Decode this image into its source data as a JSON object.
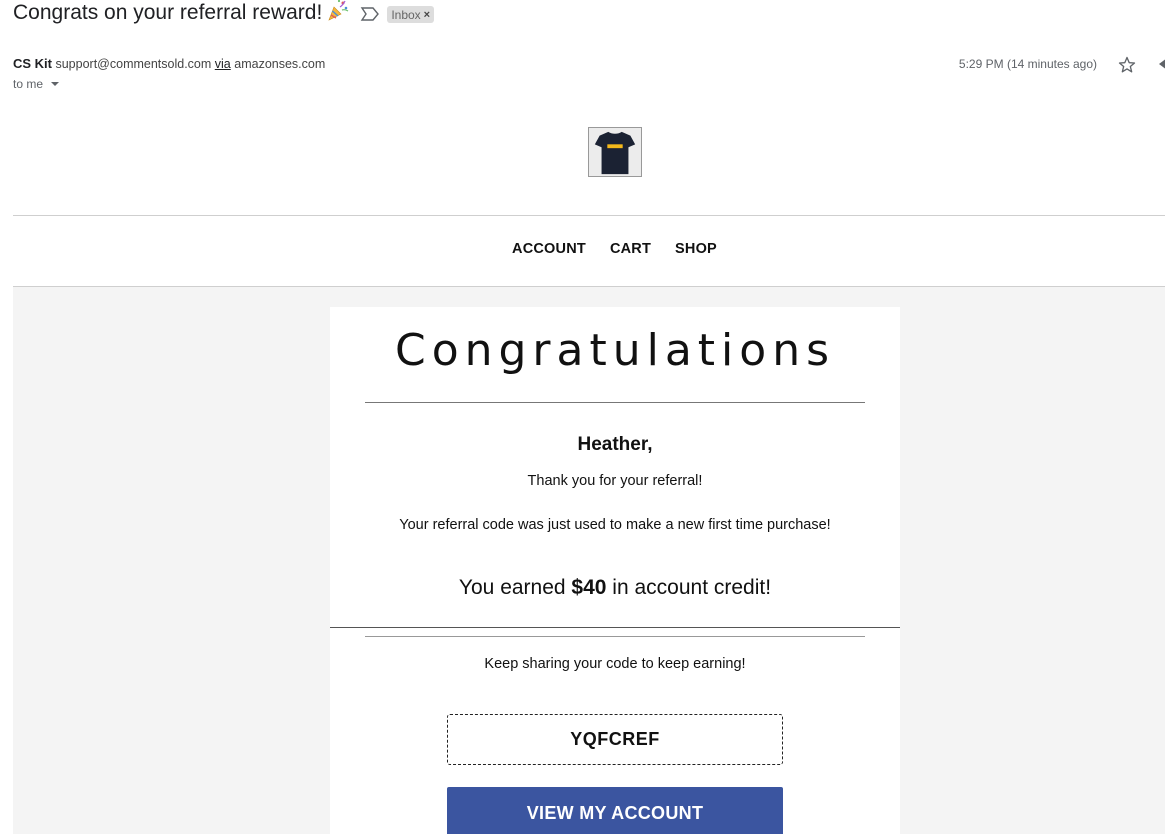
{
  "email": {
    "subject": "Congrats on your referral reward!",
    "label_chip": "Inbox",
    "label_close": "×",
    "sender_name": "CS Kit",
    "sender_email": "support@commentsold.com",
    "via_text": "via",
    "via_domain": "amazonses.com",
    "recipient": "to me",
    "timestamp": "5:29 PM (14 minutes ago)",
    "icons": [
      "party-popper-icon",
      "important-marker-icon",
      "star-icon",
      "reply-icon",
      "caret-down-icon"
    ]
  },
  "nav": {
    "items": [
      "ACCOUNT",
      "CART",
      "SHOP"
    ]
  },
  "message": {
    "title": "Congratulations",
    "greeting": "Heather,",
    "thanks": "Thank you for your referral!",
    "code_used": "Your referral code was just used to make a new first time purchase!",
    "earned_prefix": "You earned ",
    "earned_amount": "$40",
    "earned_suffix": " in account credit!",
    "keep_sharing": "Keep sharing your code to keep earning!",
    "referral_code": "YQFCREF",
    "cta_label": "VIEW MY ACCOUNT"
  },
  "colors": {
    "cta_background": "#3b55a0",
    "page_background": "#f4f4f4",
    "label_chip": "#dddddd"
  }
}
